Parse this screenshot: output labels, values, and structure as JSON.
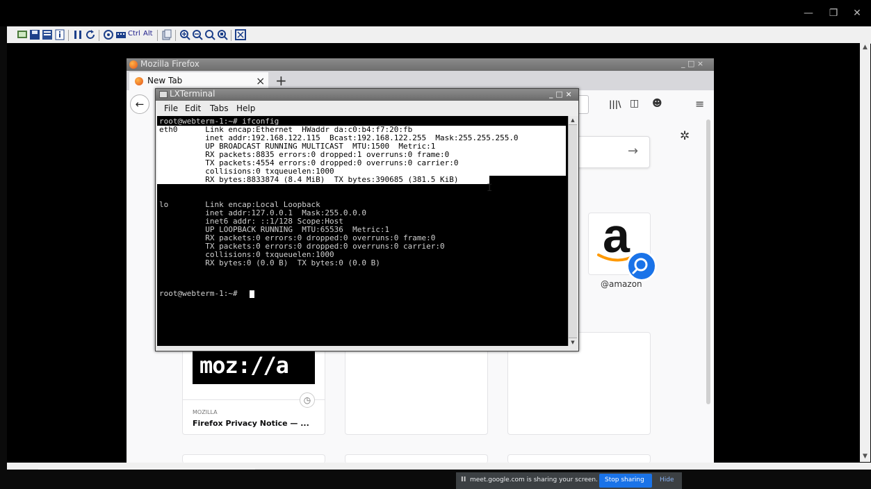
{
  "viewer": {
    "window_controls": {
      "minimize": "—",
      "restore": "❐",
      "close": "✕"
    },
    "toolbar": {
      "ctrl_label": "Ctrl",
      "alt_label": "Alt"
    }
  },
  "firefox": {
    "window_title": "Mozilla Firefox",
    "window_controls": "_ □ ×",
    "tab_title": "New Tab",
    "tab_close": "×",
    "new_tab": "+",
    "back": "←",
    "library_icon": "|||\\",
    "sidebar_icon": "◫",
    "account_icon": "☻",
    "menu_icon": "≡",
    "settings_icon": "✲",
    "search_arrow": "→",
    "top_site": {
      "label": "@amazon"
    },
    "highlight_card": {
      "logo_text": "moz://a",
      "source": "MOZILLA",
      "title": "Firefox Privacy Notice — ..."
    }
  },
  "terminal": {
    "title": "LXTerminal",
    "window_controls": "_ □ ×",
    "menu": [
      {
        "label": "File"
      },
      {
        "label": "Edit"
      },
      {
        "label": "Tabs"
      },
      {
        "label": "Help"
      }
    ],
    "lines": [
      "root@webterm-1:~# ifconfig",
      "eth0      Link encap:Ethernet  HWaddr da:c0:b4:f7:20:fb",
      "          inet addr:192.168.122.115  Bcast:192.168.122.255  Mask:255.255.255.0",
      "          UP BROADCAST RUNNING MULTICAST  MTU:1500  Metric:1",
      "          RX packets:8835 errors:0 dropped:1 overruns:0 frame:0",
      "          TX packets:4554 errors:0 dropped:0 overruns:0 carrier:0",
      "          collisions:0 txqueuelen:1000",
      "          RX bytes:8833874 (8.4 MiB)  TX bytes:390685 (381.5 KiB)",
      "",
      "lo        Link encap:Local Loopback",
      "          inet addr:127.0.0.1  Mask:255.0.0.0",
      "          inet6 addr: ::1/128 Scope:Host",
      "          UP LOOPBACK RUNNING  MTU:65536  Metric:1",
      "          RX packets:0 errors:0 dropped:0 overruns:0 frame:0",
      "          TX packets:0 errors:0 dropped:0 overruns:0 carrier:0",
      "          collisions:0 txqueuelen:1000",
      "          RX bytes:0 (0.0 B)  TX bytes:0 (0.0 B)",
      "",
      "root@webterm-1:~# "
    ]
  },
  "share_bar": {
    "pause_icon": "II",
    "message": "meet.google.com is sharing your screen.",
    "stop_label": "Stop sharing",
    "hide_label": "Hide"
  },
  "colors": {
    "selection": "#ffffff",
    "terminal_bg": "#000000",
    "share_button": "#1a73e8",
    "amazon_orange": "#ff9900",
    "search_badge": "#1a73e8"
  }
}
